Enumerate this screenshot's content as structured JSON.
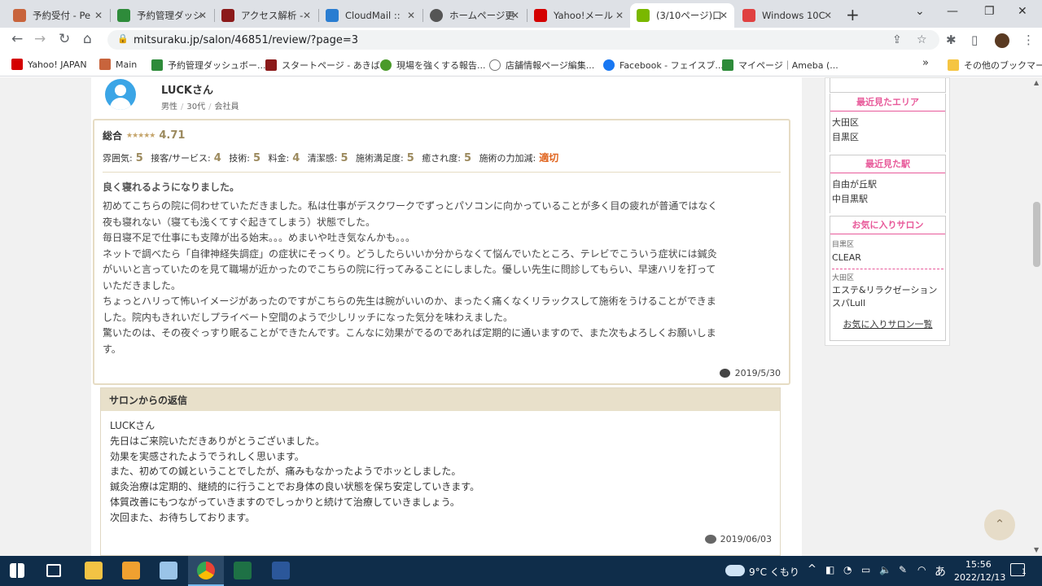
{
  "browser": {
    "tabs": [
      {
        "title": "予約受付 - Pe",
        "color": "#c8643c"
      },
      {
        "title": "予約管理ダッシ",
        "color": "#2e8b3a"
      },
      {
        "title": "アクセス解析 -",
        "color": "#8b1a1a"
      },
      {
        "title": "CloudMail :: ",
        "color": "#2a7dd1"
      },
      {
        "title": "ホームページ更",
        "color": "#555555"
      },
      {
        "title": "Yahoo!メール",
        "color": "#d40000"
      },
      {
        "title": "(3/10ページ)口",
        "color": "#7ab800"
      },
      {
        "title": "Windows 10C",
        "color": "#e04040"
      }
    ],
    "url": "mitsuraku.jp/salon/46851/review/?page=3",
    "bookmarks": [
      {
        "label": "Yahoo! JAPAN",
        "color": "#d40000"
      },
      {
        "label": "Main",
        "color": "#c8643c"
      },
      {
        "label": "予約管理ダッシュボー...",
        "color": "#2e8b3a"
      },
      {
        "label": "スタートページ - あきば...",
        "color": "#8b1a1a"
      },
      {
        "label": "現場を強くする報告...",
        "color": "#4a9a2a"
      },
      {
        "label": "店舗情報ページ編集...",
        "color": "#777777"
      },
      {
        "label": "Facebook - フェイスブ...",
        "color": "#1877f2"
      },
      {
        "label": "マイページ｜Ameba (...",
        "color": "#2e8b3a"
      }
    ],
    "bookmarks_more": "»",
    "other_bookmarks": "その他のブックマーク"
  },
  "review": {
    "name": "LUCKさん",
    "gender": "男性",
    "age": "30代",
    "job": "会社員",
    "overall_label": "総合",
    "stars": "★★★★★",
    "overall_score": "4.71",
    "scores": [
      {
        "label": "雰囲気:",
        "value": "5"
      },
      {
        "label": "接客/サービス:",
        "value": "4"
      },
      {
        "label": "技術:",
        "value": "5"
      },
      {
        "label": "料金:",
        "value": "4"
      },
      {
        "label": "清潔感:",
        "value": "5"
      },
      {
        "label": "施術満足度:",
        "value": "5"
      },
      {
        "label": "癒され度:",
        "value": "5"
      },
      {
        "label": "施術の力加減:",
        "value": "適切"
      }
    ],
    "title": "良く寝れるようになりました。",
    "body": [
      "初めてこちらの院に伺わせていただきました。私は仕事がデスクワークでずっとパソコンに向かっていることが多く目の疲れが普通ではなく",
      "夜も寝れない（寝ても浅くてすぐ起きてしまう）状態でした。",
      "毎日寝不足で仕事にも支障が出る始末。。。めまいや吐き気なんかも。。。",
      "ネットで調べたら「自律神経失調症」の症状にそっくり。どうしたらいいか分からなくて悩んでいたところ、テレビでこういう症状には鍼灸",
      "がいいと言っていたのを見て職場が近かったのでこちらの院に行ってみることにしました。優しい先生に問診してもらい、早速ハリを打って",
      "いただきました。",
      "ちょっとハリって怖いイメージがあったのですがこちらの先生は腕がいいのか、まったく痛くなくリラックスして施術をうけることができま",
      "した。院内もきれいだしプライベート空間のようで少しリッチになった気分を味わえました。",
      "驚いたのは、その夜ぐっすり眠ることができたんです。こんなに効果がでるのであれば定期的に通いますので、また次もよろしくお願いしま",
      "す。"
    ],
    "date": "2019/5/30"
  },
  "reply": {
    "heading": "サロンからの返信",
    "body": [
      "LUCKさん",
      "先日はご来院いただきありがとうございました。",
      "効果を実感されたようでうれしく思います。",
      "また、初めての鍼ということでしたが、痛みもなかったようでホッとしました。",
      "鍼灸治療は定期的、継続的に行うことでお身体の良い状態を保ち安定していきます。",
      "体質改善にもつながっていきますのでしっかりと続けて治療していきましょう。",
      "次回また、お待ちしております。"
    ],
    "date": "2019/06/03"
  },
  "sidebar": {
    "recent_area_heading": "最近見たエリア",
    "recent_areas": [
      "大田区",
      "目黒区"
    ],
    "recent_station_heading": "最近見た駅",
    "recent_stations": [
      "自由が丘駅",
      "中目黒駅"
    ],
    "fav_heading": "お気に入りサロン",
    "favorites": [
      {
        "area": "目黒区",
        "name": "CLEAR"
      },
      {
        "area": "大田区",
        "name": "エステ&リラクゼーションスパLull"
      }
    ],
    "fav_link": "お気に入りサロン一覧"
  },
  "taskbar": {
    "weather": "9°C くもり",
    "ime": "あ",
    "time": "15:56",
    "date": "2022/12/13",
    "notifications": "1"
  }
}
